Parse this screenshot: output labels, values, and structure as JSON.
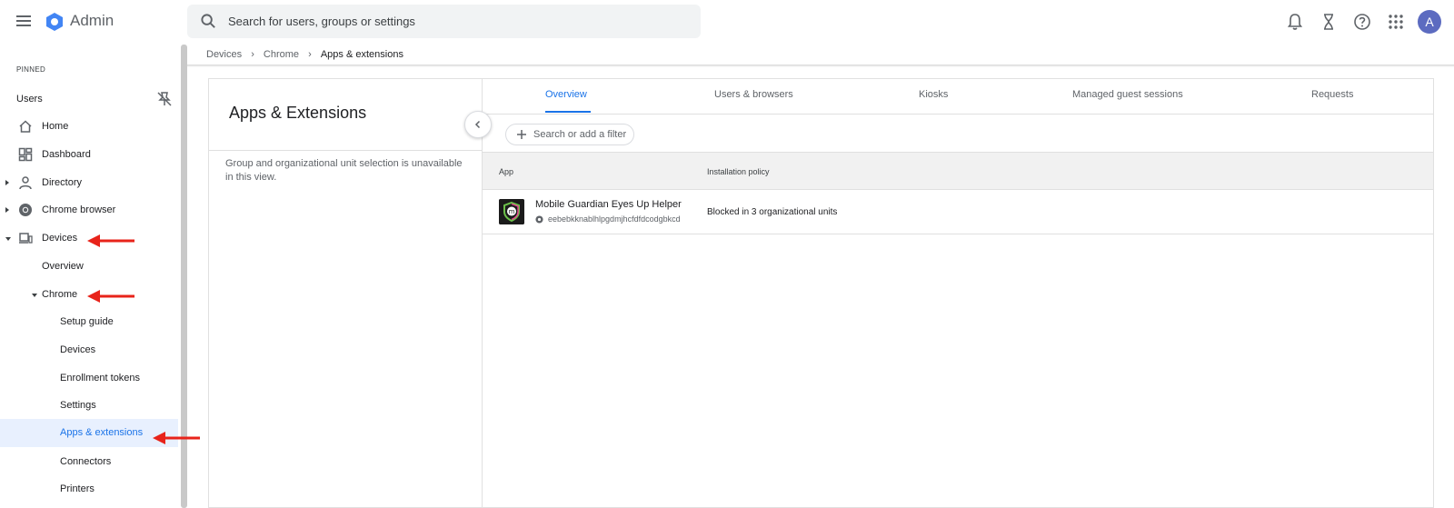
{
  "topbar": {
    "brand": "Admin",
    "search_placeholder": "Search for users, groups or settings",
    "avatar_letter": "A"
  },
  "sidebar": {
    "section": "PINNED",
    "items": [
      {
        "label": "Users"
      },
      {
        "label": "Home"
      },
      {
        "label": "Dashboard"
      },
      {
        "label": "Directory"
      },
      {
        "label": "Chrome browser"
      },
      {
        "label": "Devices"
      },
      {
        "label": "Overview"
      },
      {
        "label": "Chrome"
      },
      {
        "label": "Setup guide"
      },
      {
        "label": "Devices"
      },
      {
        "label": "Enrollment tokens"
      },
      {
        "label": "Settings"
      },
      {
        "label": "Apps & extensions"
      },
      {
        "label": "Connectors"
      },
      {
        "label": "Printers"
      }
    ]
  },
  "breadcrumb": [
    "Devices",
    "Chrome",
    "Apps & extensions"
  ],
  "left_pane": {
    "title": "Apps & Extensions",
    "note": "Group and organizational unit selection is unavailable in this view."
  },
  "tabs": [
    "Overview",
    "Users & browsers",
    "Kiosks",
    "Managed guest sessions",
    "Requests"
  ],
  "filter": {
    "label": "Search or add a filter"
  },
  "table": {
    "columns": [
      "App",
      "Installation policy"
    ],
    "rows": [
      {
        "name": "Mobile Guardian Eyes Up Helper",
        "id": "eebebkknablhlpgdmjhcfdfdcodgbkcd",
        "policy": "Blocked in 3 organizational units"
      }
    ]
  },
  "colors": {
    "accent": "#1a73e8",
    "annotation_arrow": "#e8231a",
    "active_bg": "#e8f0fe"
  }
}
